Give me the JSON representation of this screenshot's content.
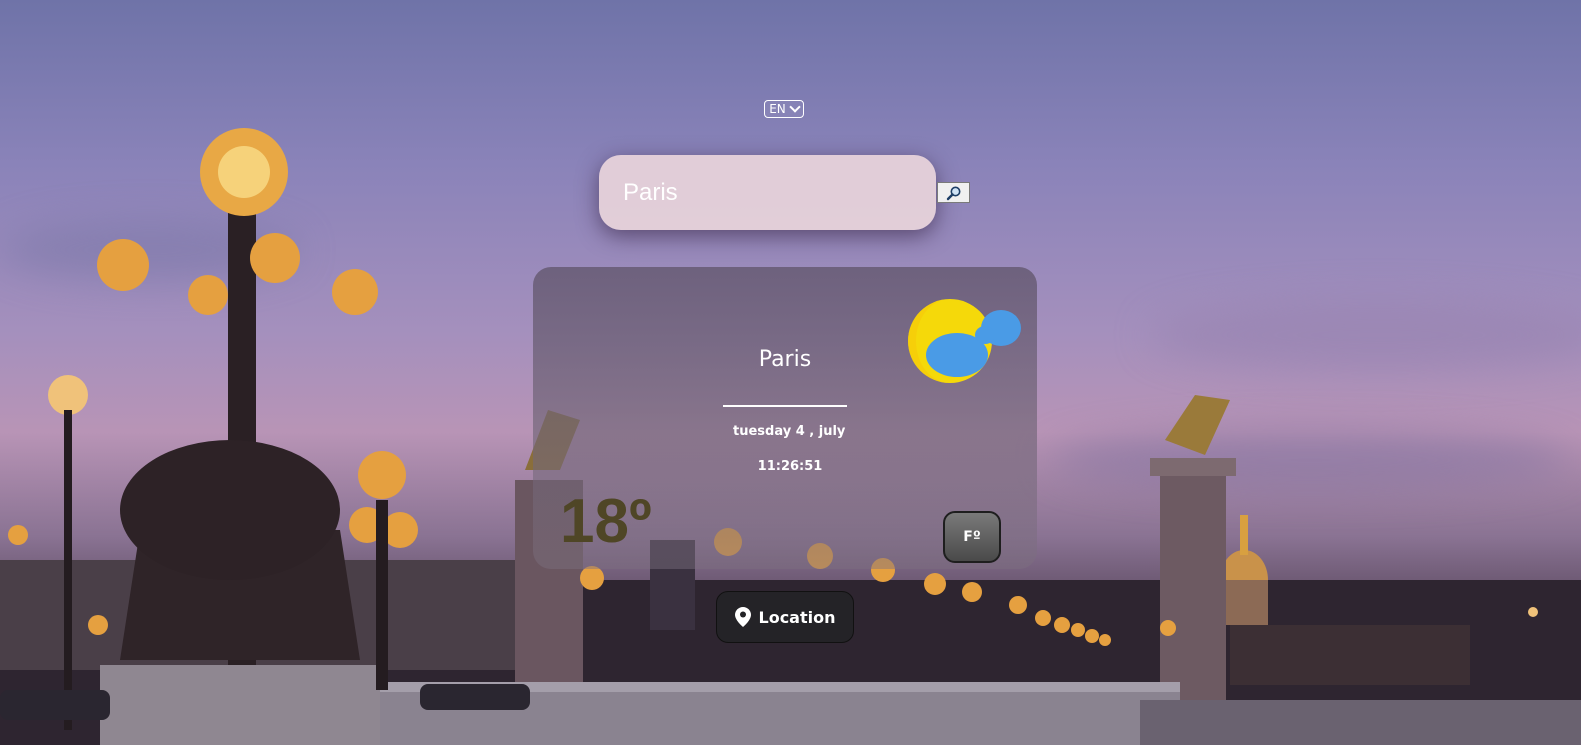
{
  "language": {
    "selected": "EN"
  },
  "search": {
    "value": "Paris"
  },
  "weather": {
    "city": "Paris",
    "date": "tuesday 4 , july",
    "time": "11:26:51",
    "temperature": "18º",
    "unit_toggle_label": "Fº",
    "condition_icon": "sun-behind-cloud-icon"
  },
  "location_button": {
    "label": "Location",
    "icon": "map-pin-icon"
  },
  "colors": {
    "sun": "#f5d90a",
    "cloud": "#4a9be6",
    "temperature_text": "#4f4626"
  }
}
